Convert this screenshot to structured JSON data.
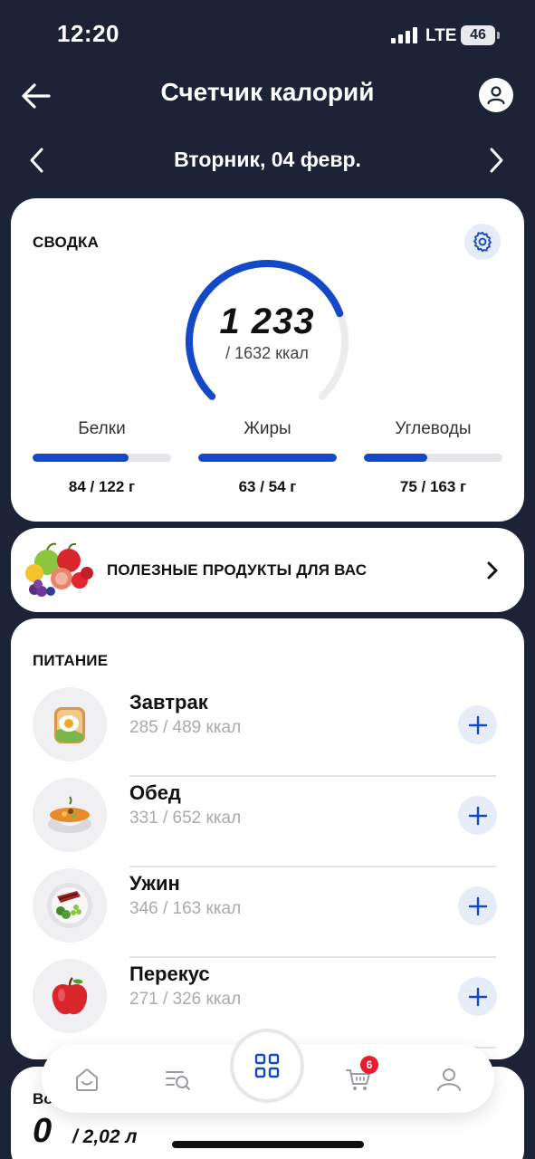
{
  "status_bar": {
    "time": "12:20",
    "network": "LTE",
    "battery": "46"
  },
  "header": {
    "title": "Счетчик калорий"
  },
  "date_nav": {
    "label": "Вторник, 04 февр."
  },
  "summary": {
    "title": "СВОДКА",
    "kcal_eaten": "1 233",
    "kcal_goal": "/ 1632 ккал",
    "kcal_progress": 0.7555,
    "macros": [
      {
        "name": "Белки",
        "value": "84 / 122 г",
        "progress": 0.69
      },
      {
        "name": "Жиры",
        "value": "63 / 54 г",
        "progress": 1.0
      },
      {
        "name": "Углеводы",
        "value": "75 / 163 г",
        "progress": 0.46
      }
    ]
  },
  "banner": {
    "text": "ПОЛЕЗНЫЕ ПРОДУКТЫ ДЛЯ ВАС"
  },
  "meals": {
    "title": "ПИТАНИЕ",
    "items": [
      {
        "name": "Завтрак",
        "kcal": "285 / 489 ккал",
        "icon": "toast-egg-icon"
      },
      {
        "name": "Обед",
        "kcal": "331 / 652 ккал",
        "icon": "soup-bowl-icon"
      },
      {
        "name": "Ужин",
        "kcal": "346 / 163 ккал",
        "icon": "dinner-plate-icon"
      },
      {
        "name": "Перекус",
        "kcal": "271 / 326 ккал",
        "icon": "apple-icon"
      }
    ]
  },
  "water": {
    "title": "Во",
    "value": "0",
    "goal": "/ 2,02 л"
  },
  "nav": {
    "items": [
      "home-icon",
      "search-list-icon",
      "grid-icon",
      "cart-icon",
      "profile-icon"
    ],
    "cart_count": "6"
  },
  "colors": {
    "background": "#1c2337",
    "accent": "#1348c6",
    "badge": "#e51d2c"
  }
}
